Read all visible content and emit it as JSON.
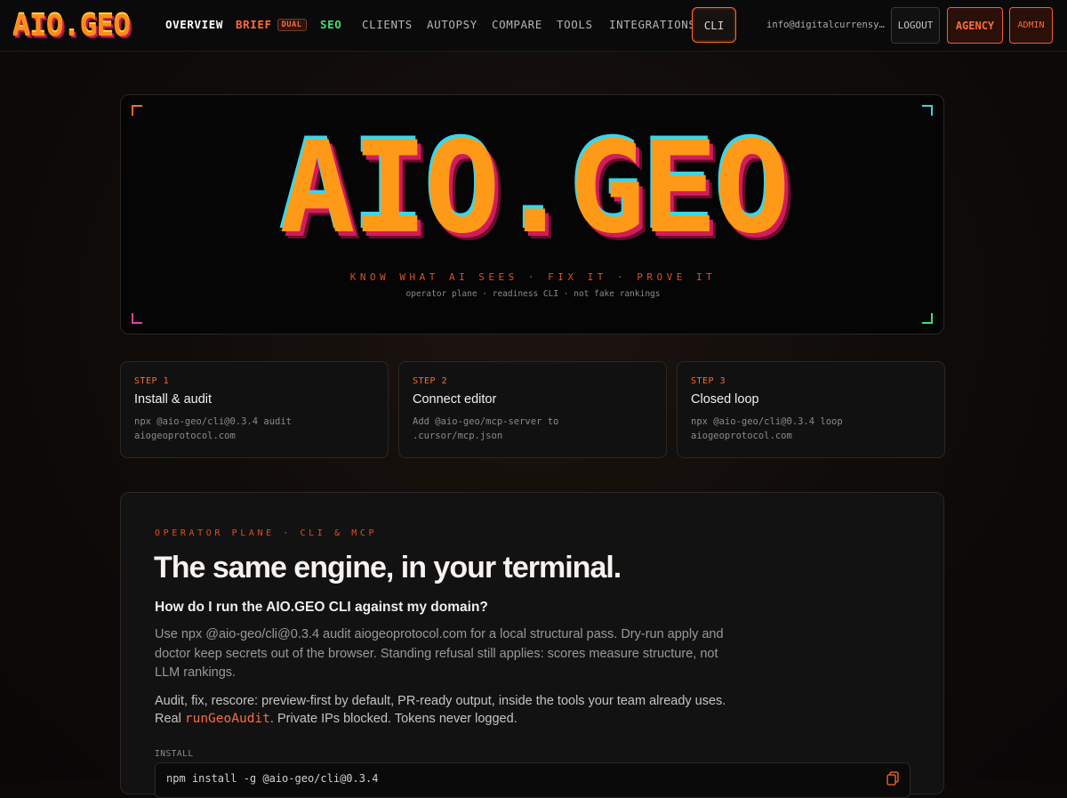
{
  "nav": {
    "logo": "AIO.GEO",
    "items": [
      {
        "label": "OVERVIEW"
      },
      {
        "label": "BRIEF",
        "badge": "DUAL"
      },
      {
        "label": "SEO"
      },
      {
        "label": "CLIENTS"
      },
      {
        "label": "AUTOPSY"
      },
      {
        "label": "COMPARE"
      },
      {
        "label": "TOOLS"
      },
      {
        "label": "INTEGRATIONS"
      }
    ],
    "cli": "CLI",
    "email": "info@digitalcurrensy.c…",
    "logout": "LOGOUT",
    "agency": "AGENCY",
    "admin": "ADMIN"
  },
  "hero": {
    "logo": "AIO.GEO",
    "tagline": "KNOW WHAT AI SEES · FIX IT · PROVE IT",
    "subtagline": "operator plane · readiness CLI · not fake rankings"
  },
  "steps": [
    {
      "label": "STEP 1",
      "title": "Install & audit",
      "cmd_line1": "npx @aio-geo/cli@0.3.4 audit",
      "cmd_line2": "aiogeoprotocol.com"
    },
    {
      "label": "STEP 2",
      "title": "Connect editor",
      "cmd_line1": "Add @aio-geo/mcp-server to",
      "cmd_line2": ".cursor/mcp.json"
    },
    {
      "label": "STEP 3",
      "title": "Closed loop",
      "cmd_line1": "npx @aio-geo/cli@0.3.4 loop",
      "cmd_line2": "aiogeoprotocol.com"
    }
  ],
  "operator": {
    "eyebrow": "OPERATOR PLANE · CLI & MCP",
    "headline": "The same engine, in your terminal.",
    "question": "How do I run the AIO.GEO CLI against my domain?",
    "answer": "Use npx @aio-geo/cli@0.3.4 audit aiogeoprotocol.com for a local structural pass. Dry-run apply and doctor keep secrets out of the browser. Standing refusal still applies: scores measure structure, not LLM rankings.",
    "answer2_part1": "Audit, fix, rescore: preview-first by default, PR-ready output, inside the tools your team already uses. Real ",
    "answer2_code": "runGeoAudit",
    "answer2_part2": ". Private IPs blocked. Tokens never logged.",
    "install_label": "INSTALL",
    "install_cmd": "npm install -g @aio-geo/cli@0.3.4"
  },
  "colors": {
    "accent": "#ff6a2a",
    "seo": "#39e07a",
    "cyan": "#3fd2e8",
    "magenta": "#e040a0"
  }
}
